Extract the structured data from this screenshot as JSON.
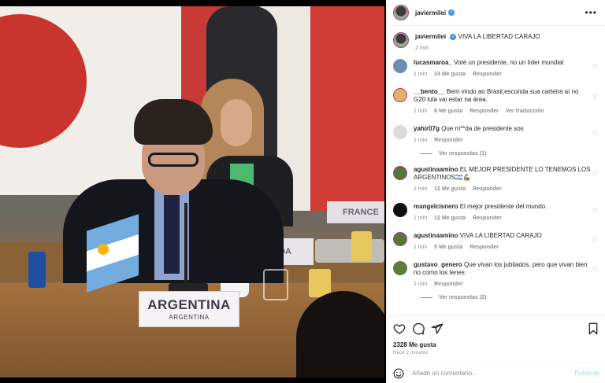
{
  "post": {
    "username": "javiermilei",
    "caption_text": "VIVA LA LIBERTAD CARAJO",
    "caption_time": "2 min"
  },
  "photo": {
    "placard_main": "ARGENTINA",
    "placard_sub": "ARGENTINA",
    "placard_fr": "FRANCE",
    "placard_ada": "ADA"
  },
  "comments": [
    {
      "user": "lucasmaroa_",
      "text": "Voté un presidente, no un líder mundial",
      "time": "1 min",
      "likes": "24 Me gusta",
      "reply": "Responder",
      "avatar_color": "#6b8fb3"
    },
    {
      "user": "__bento__",
      "text": "Bem vindo ao Brasil,esconda sua carteira aí no G20 lula vai estar na área.",
      "time": "1 min",
      "likes": "6 Me gusta",
      "reply": "Responder",
      "translate": "Ver traducción",
      "avatar_color": "#e0b36a"
    },
    {
      "user": "yahir07g",
      "text": "Que m**da de presidente sos",
      "time": "1 min",
      "reply": "Responder",
      "replies": "Ver respuestas (1)",
      "avatar_color": "#dbdbdb"
    },
    {
      "user": "agustinaamino",
      "text": "EL MEJOR PRESIDENTE LO TENEMOS LOS ARGENTINOS🇦🇷💪🏽",
      "time": "1 min",
      "likes": "12 Me gusta",
      "reply": "Responder",
      "avatar_color": "#4f7a3a"
    },
    {
      "user": "mangelcisnero",
      "text": "El mejor presidente del mundo.",
      "time": "1 min",
      "likes": "12 Me gusta",
      "reply": "Responder",
      "avatar_color": "#111111"
    },
    {
      "user": "agustinaamino",
      "text": "VIVA LA LIBERTAD CARAJO",
      "time": "1 min",
      "likes": "5 Me gusta",
      "reply": "Responder",
      "avatar_color": "#4f7a3a"
    },
    {
      "user": "gustavo_genero",
      "text": "Que vivan los jubilados, pero que vivan bien no como los tenes",
      "time": "1 min",
      "reply": "Responder",
      "replies": "Ver respuestas (2)",
      "avatar_color": "#5c7d3b"
    }
  ],
  "footer": {
    "likes": "2328 Me gusta",
    "ago": "Hace 2 minutos",
    "comment_placeholder": "Añade un comentario...",
    "publish": "Publicar"
  },
  "icons": [
    "heart-icon",
    "comment-icon",
    "share-icon",
    "bookmark-icon",
    "emoji-icon",
    "more-icon",
    "verified-icon"
  ],
  "colors": {
    "verified": "#3897f0",
    "link_muted": "#8e8e8e",
    "publish_disabled": "#b2dffc",
    "story_ring": "#c13584"
  }
}
